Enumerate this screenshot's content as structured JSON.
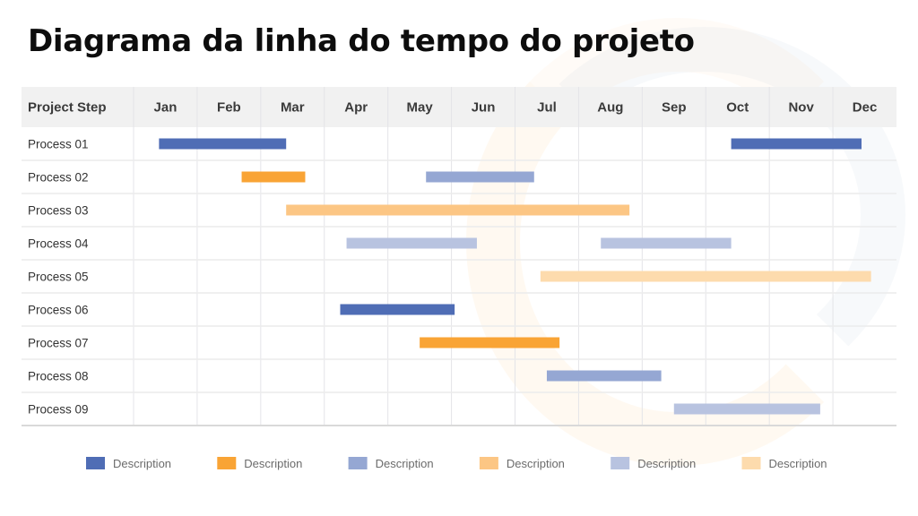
{
  "title": "Diagrama da linha do tempo do projeto",
  "chart_data": {
    "type": "gantt",
    "title": "Diagrama da linha do tempo do projeto",
    "row_header": "Project Step",
    "categories": [
      "Jan",
      "Feb",
      "Mar",
      "Apr",
      "May",
      "Jun",
      "Jul",
      "Aug",
      "Sep",
      "Oct",
      "Nov",
      "Dec"
    ],
    "x_unit": "months from start of Jan",
    "xlim": [
      0,
      12
    ],
    "grid": true,
    "legend_position": "bottom",
    "series": [
      {
        "name": "Description",
        "color": "#4f6db5"
      },
      {
        "name": "Description",
        "color": "#f9a435"
      },
      {
        "name": "Description",
        "color": "#95a7d3"
      },
      {
        "name": "Description",
        "color": "#fcc684"
      },
      {
        "name": "Description",
        "color": "#b8c3e0"
      },
      {
        "name": "Description",
        "color": "#fddbad"
      }
    ],
    "rows": [
      {
        "label": "Process 01",
        "bars": [
          {
            "start": 0.4,
            "end": 2.4,
            "series": 0
          },
          {
            "start": 9.4,
            "end": 11.45,
            "series": 0
          }
        ]
      },
      {
        "label": "Process 02",
        "bars": [
          {
            "start": 1.7,
            "end": 2.7,
            "series": 1
          },
          {
            "start": 4.6,
            "end": 6.3,
            "series": 2
          }
        ]
      },
      {
        "label": "Process 03",
        "bars": [
          {
            "start": 2.4,
            "end": 7.8,
            "series": 3
          }
        ]
      },
      {
        "label": "Process 04",
        "bars": [
          {
            "start": 3.35,
            "end": 5.4,
            "series": 4
          },
          {
            "start": 7.35,
            "end": 9.4,
            "series": 4
          }
        ]
      },
      {
        "label": "Process 05",
        "bars": [
          {
            "start": 6.4,
            "end": 11.6,
            "series": 5
          }
        ]
      },
      {
        "label": "Process 06",
        "bars": [
          {
            "start": 3.25,
            "end": 5.05,
            "series": 0
          }
        ]
      },
      {
        "label": "Process 07",
        "bars": [
          {
            "start": 4.5,
            "end": 6.7,
            "series": 1
          }
        ]
      },
      {
        "label": "Process 08",
        "bars": [
          {
            "start": 6.5,
            "end": 8.3,
            "series": 2
          }
        ]
      },
      {
        "label": "Process 09",
        "bars": [
          {
            "start": 8.5,
            "end": 10.8,
            "series": 4
          }
        ]
      }
    ]
  }
}
